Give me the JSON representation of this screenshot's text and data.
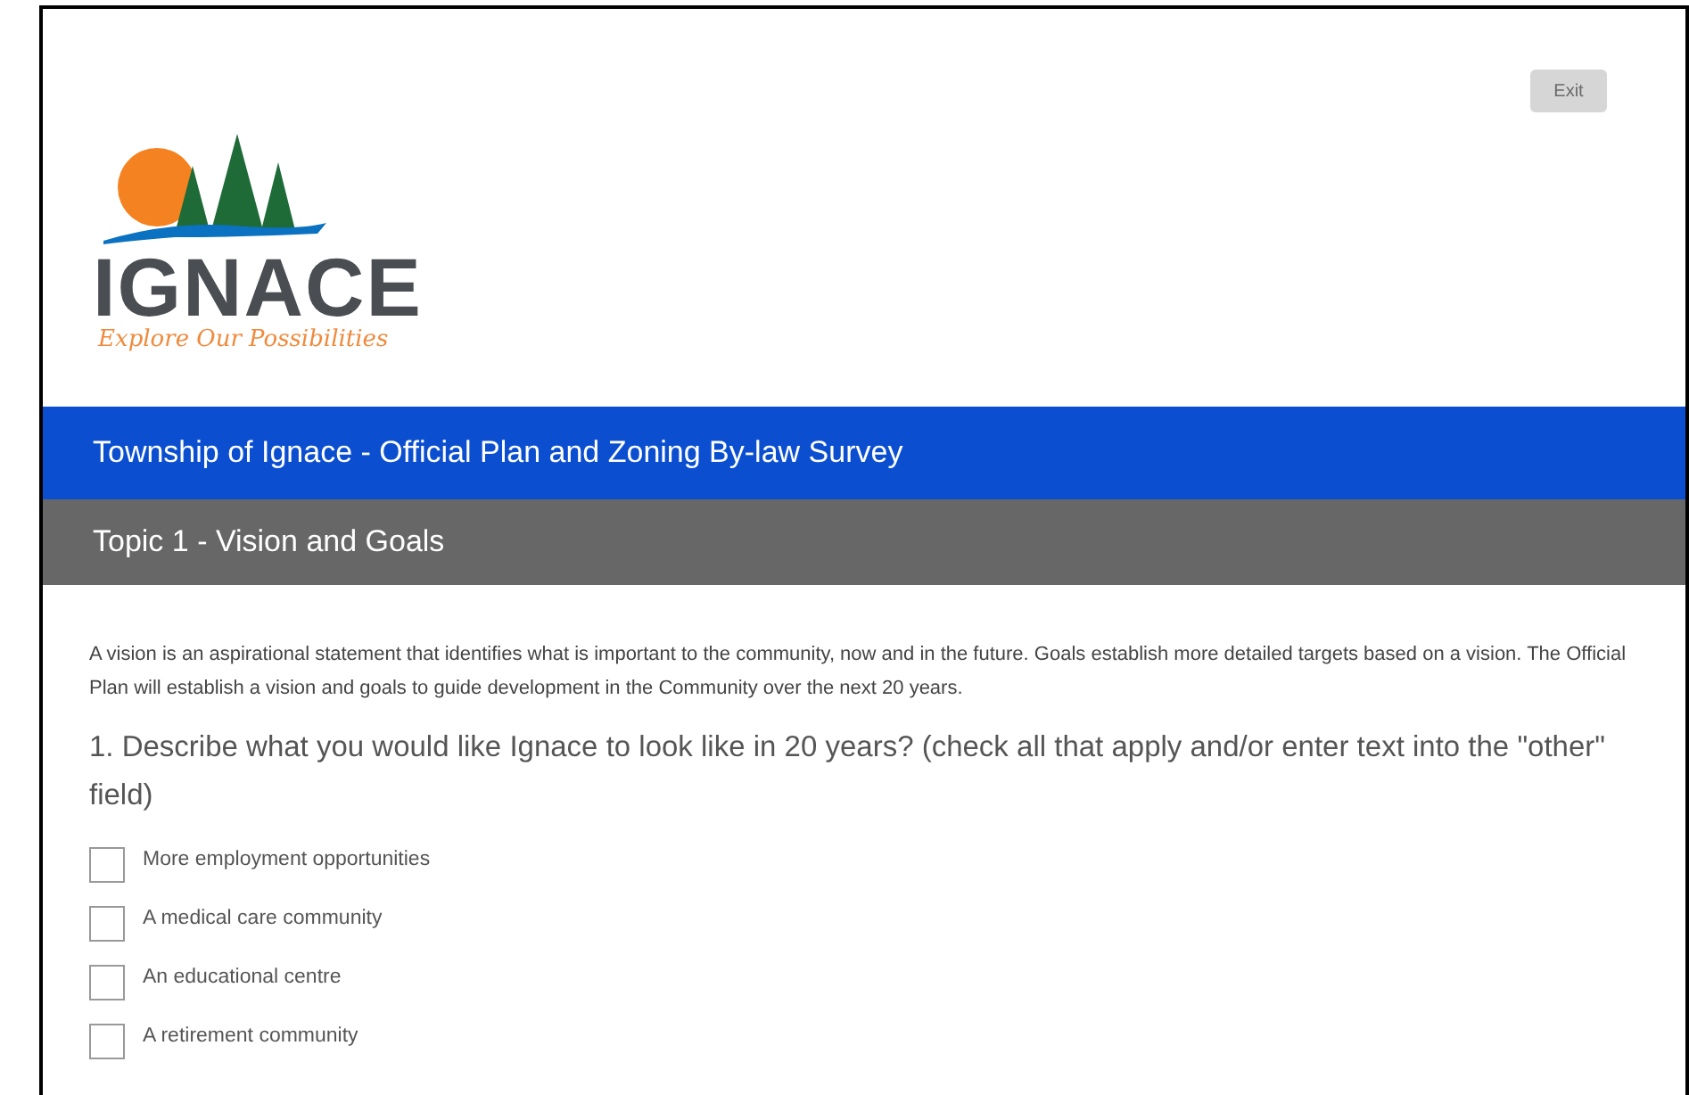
{
  "exit_button": {
    "label": "Exit",
    "disabled": true
  },
  "logo": {
    "name": "IGNACE",
    "tagline": "Explore Our Possibilities"
  },
  "survey_title": "Township of Ignace - Official Plan and Zoning By-law Survey",
  "topic_title": "Topic 1 - Vision and Goals",
  "intro": "A vision is an aspirational statement that identifies what is important to the community, now and in the future. Goals establish more detailed targets based on a vision. The Official Plan will establish a vision and goals to guide development in the Community over the next 20 years.",
  "question": "1. Describe what you would like Ignace to look like in 20 years? (check all that apply and/or enter text into the \"other\" field)",
  "options": [
    {
      "label": "More employment opportunities",
      "checked": false
    },
    {
      "label": "A medical care community",
      "checked": false
    },
    {
      "label": "An educational centre",
      "checked": false
    },
    {
      "label": "A retirement community",
      "checked": false
    }
  ]
}
